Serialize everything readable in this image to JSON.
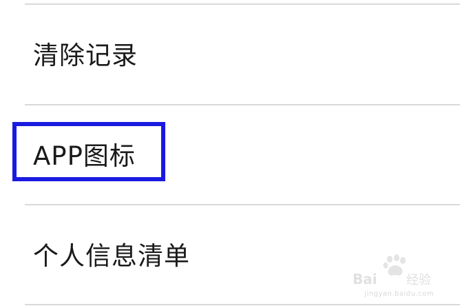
{
  "settings": {
    "items": [
      {
        "label": "清除记录"
      },
      {
        "label": "APP图标"
      },
      {
        "label": "个人信息清单"
      }
    ],
    "highlight_color": "#1a1ae0"
  },
  "watermark": {
    "logo_text": "Bai",
    "logo_suffix": "经验",
    "url": "jingyan.baidu.com"
  }
}
